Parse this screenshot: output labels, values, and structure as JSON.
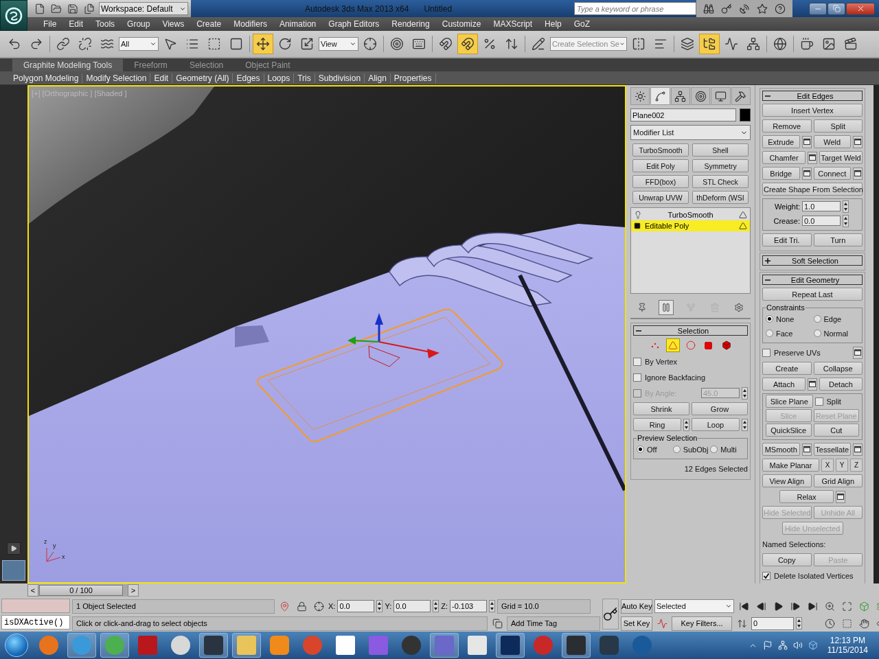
{
  "title_bar": {
    "quick_access": [
      {
        "kind": "new"
      },
      {
        "kind": "open"
      },
      {
        "kind": "save"
      },
      {
        "kind": "project"
      }
    ],
    "workspace": "Workspace: Default",
    "title": "Autodesk 3ds Max  2013 x64",
    "document": "Untitled",
    "search": {
      "placeholder": "Type a keyword or phrase"
    },
    "tools": [
      {
        "kind": "binoculars"
      },
      {
        "kind": "key"
      },
      {
        "kind": "satellite"
      },
      {
        "kind": "star"
      },
      {
        "kind": "help"
      }
    ]
  },
  "menu": [
    "File",
    "Edit",
    "Tools",
    "Group",
    "Views",
    "Create",
    "Modifiers",
    "Animation",
    "Graph Editors",
    "Rendering",
    "Customize",
    "MAXScript",
    "Help",
    "GoZ"
  ],
  "main_toolbar": [
    {
      "kind": "undo",
      "active": false
    },
    {
      "kind": "redo",
      "active": false
    },
    {
      "kind": "sep"
    },
    {
      "kind": "link",
      "active": false
    },
    {
      "kind": "unlink",
      "active": false
    },
    {
      "kind": "bind",
      "active": false
    },
    {
      "kind": "dropdown",
      "value": "All"
    },
    {
      "kind": "select",
      "active": false
    },
    {
      "kind": "select_name",
      "active": false
    },
    {
      "kind": "region",
      "active": false
    },
    {
      "kind": "crossing",
      "active": false
    },
    {
      "kind": "sep"
    },
    {
      "kind": "move",
      "active": true
    },
    {
      "kind": "rotate",
      "active": false
    },
    {
      "kind": "scale",
      "active": false
    },
    {
      "kind": "dropdown",
      "value": "View"
    },
    {
      "kind": "pivot",
      "active": false
    },
    {
      "kind": "sep"
    },
    {
      "kind": "manipulate",
      "active": false
    },
    {
      "kind": "keyboard",
      "active": false
    },
    {
      "kind": "sep"
    },
    {
      "kind": "snap",
      "active": false
    },
    {
      "kind": "angle_snap",
      "active": true
    },
    {
      "kind": "percent",
      "active": false
    },
    {
      "kind": "spinner_snap",
      "active": false
    },
    {
      "kind": "sep"
    },
    {
      "kind": "named_edit",
      "active": false
    },
    {
      "kind": "named_set",
      "placeholder": "Create Selection Se"
    },
    {
      "kind": "mirror",
      "active": false
    },
    {
      "kind": "align",
      "active": false
    },
    {
      "kind": "sep"
    },
    {
      "kind": "layers",
      "active": false
    },
    {
      "kind": "explorer",
      "active": true
    },
    {
      "kind": "curve",
      "active": false
    },
    {
      "kind": "schematic",
      "active": false
    },
    {
      "kind": "sep"
    },
    {
      "kind": "material",
      "active": false
    },
    {
      "kind": "sep"
    },
    {
      "kind": "render_setup",
      "active": false
    },
    {
      "kind": "render_frame",
      "active": false
    },
    {
      "kind": "render",
      "active": false
    }
  ],
  "ribbon": {
    "tabs": [
      {
        "label": "Graphite Modeling Tools",
        "selected": true
      },
      {
        "label": "Freeform",
        "selected": false
      },
      {
        "label": "Selection",
        "selected": false
      },
      {
        "label": "Object Paint",
        "selected": false
      }
    ],
    "panels": [
      "Polygon Modeling",
      "Modify Selection",
      "Edit",
      "Geometry (All)",
      "Edges",
      "Loops",
      "Tris",
      "Subdivision",
      "Align",
      "Properties"
    ]
  },
  "viewport": {
    "label": "[+] [Orthographic ] [Shaded ]",
    "axis_labels": [
      "z",
      "y",
      "x"
    ]
  },
  "command_panel": {
    "tabs": [
      {
        "kind": "create",
        "selected": false
      },
      {
        "kind": "modify",
        "selected": true
      },
      {
        "kind": "hierarchy",
        "selected": false
      },
      {
        "kind": "motion",
        "selected": false
      },
      {
        "kind": "display",
        "selected": false
      },
      {
        "kind": "utilities",
        "selected": false
      }
    ],
    "object_name": "Plane002",
    "modifier_list": "Modifier List",
    "modifier_buttons": [
      "TurboSmooth",
      "Shell",
      "Edit Poly",
      "Symmetry",
      "FFD(box)",
      "STL Check",
      "Unwrap UVW",
      "thDeform (WSI"
    ],
    "stack": [
      {
        "kind": "modifier",
        "label": "TurboSmooth",
        "selected": false
      },
      {
        "kind": "base",
        "label": "Editable Poly",
        "selected": true
      }
    ],
    "stack_tools": [
      {
        "kind": "pin",
        "active": false,
        "disabled": false
      },
      {
        "kind": "end_result",
        "active": true,
        "disabled": false
      },
      {
        "kind": "make_unique",
        "active": false,
        "disabled": true
      },
      {
        "kind": "remove",
        "active": false,
        "disabled": true
      },
      {
        "kind": "configure",
        "active": false,
        "disabled": false
      }
    ],
    "selection": {
      "title": "Selection",
      "expanded": true,
      "subobjects": [
        {
          "kind": "vertex",
          "selected": false
        },
        {
          "kind": "edge",
          "selected": true
        },
        {
          "kind": "border",
          "selected": false
        },
        {
          "kind": "polygon",
          "selected": false
        },
        {
          "kind": "element",
          "selected": false
        }
      ],
      "rows": [
        [
          {
            "kind": "checkbox",
            "label": "By Vertex",
            "checked": false,
            "disabled": false
          }
        ],
        [
          {
            "kind": "checkbox",
            "label": "Ignore Backfacing",
            "checked": false,
            "disabled": false
          }
        ],
        [
          {
            "kind": "checkbox",
            "label": "By Angle:",
            "checked": false,
            "disabled": true
          },
          {
            "kind": "spinner",
            "value": "45.0",
            "disabled": true
          }
        ],
        [
          {
            "kind": "button",
            "label": "Shrink",
            "disabled": false
          },
          {
            "kind": "button",
            "label": "Grow",
            "disabled": false
          }
        ],
        [
          {
            "kind": "button",
            "label": "Ring",
            "disabled": false
          },
          {
            "kind": "arrows"
          },
          {
            "kind": "button",
            "label": "Loop",
            "disabled": false
          },
          {
            "kind": "arrows"
          }
        ],
        [
          {
            "kind": "group",
            "title": "Preview Selection",
            "rows": [
              [
                {
                  "kind": "radio",
                  "label": "Off",
                  "selected": true
                },
                {
                  "kind": "radio",
                  "label": "SubObj",
                  "selected": false
                },
                {
                  "kind": "radio",
                  "label": "Multi",
                  "selected": false
                }
              ]
            ]
          }
        ],
        [
          {
            "kind": "status",
            "label": "12 Edges Selected"
          }
        ]
      ]
    }
  },
  "rollouts": [
    {
      "title": "Edit Edges",
      "expanded": true,
      "rows": [
        [
          {
            "kind": "button",
            "label": "Insert Vertex",
            "disabled": false
          }
        ],
        [
          {
            "kind": "button",
            "label": "Remove",
            "disabled": false
          },
          {
            "kind": "button",
            "label": "Split",
            "disabled": false
          }
        ],
        [
          {
            "kind": "button",
            "label": "Extrude",
            "disabled": false
          },
          {
            "kind": "settings"
          },
          {
            "kind": "button",
            "label": "Weld",
            "disabled": false
          },
          {
            "kind": "settings"
          }
        ],
        [
          {
            "kind": "button",
            "label": "Chamfer",
            "disabled": false
          },
          {
            "kind": "settings"
          },
          {
            "kind": "button",
            "label": "Target Weld",
            "disabled": false
          }
        ],
        [
          {
            "kind": "button",
            "label": "Bridge",
            "disabled": false
          },
          {
            "kind": "settings"
          },
          {
            "kind": "button",
            "label": "Connect",
            "disabled": false
          },
          {
            "kind": "settings"
          }
        ],
        [
          {
            "kind": "button",
            "label": "Create Shape From Selection",
            "disabled": false
          }
        ],
        [
          {
            "kind": "group",
            "rows": [
              [
                {
                  "kind": "spinner",
                  "label": "Weight:",
                  "value": "1.0",
                  "disabled": false
                }
              ],
              [
                {
                  "kind": "spinner",
                  "label": "Crease:",
                  "value": "0.0",
                  "disabled": false
                }
              ]
            ]
          }
        ],
        [
          {
            "kind": "button",
            "label": "Edit Tri.",
            "disabled": false
          },
          {
            "kind": "button",
            "label": "Turn",
            "disabled": false
          }
        ]
      ]
    },
    {
      "title": "Soft Selection",
      "expanded": false
    },
    {
      "title": "Edit Geometry",
      "expanded": true,
      "rows": [
        [
          {
            "kind": "button",
            "label": "Repeat Last",
            "disabled": false
          }
        ],
        [
          {
            "kind": "group",
            "title": "Constraints",
            "rows": [
              [
                {
                  "kind": "radio",
                  "label": "None",
                  "selected": true
                },
                {
                  "kind": "radio",
                  "label": "Edge",
                  "selected": false
                }
              ],
              [
                {
                  "kind": "radio",
                  "label": "Face",
                  "selected": false
                },
                {
                  "kind": "radio",
                  "label": "Normal",
                  "selected": false
                }
              ]
            ]
          }
        ],
        [
          {
            "kind": "checkbox",
            "label": "Preserve UVs",
            "checked": false,
            "disabled": false
          },
          {
            "kind": "settings"
          }
        ],
        [
          {
            "kind": "button",
            "label": "Create",
            "disabled": false
          },
          {
            "kind": "button",
            "label": "Collapse",
            "disabled": false
          }
        ],
        [
          {
            "kind": "button",
            "label": "Attach",
            "disabled": false
          },
          {
            "kind": "settings"
          },
          {
            "kind": "button",
            "label": "Detach",
            "disabled": false
          }
        ],
        [
          {
            "kind": "group",
            "rows": [
              [
                {
                  "kind": "button",
                  "label": "Slice Plane",
                  "disabled": false
                },
                {
                  "kind": "checkbox",
                  "label": "Split",
                  "checked": false,
                  "disabled": false
                }
              ],
              [
                {
                  "kind": "button",
                  "label": "Slice",
                  "disabled": true
                },
                {
                  "kind": "button",
                  "label": "Reset Plane",
                  "disabled": true
                }
              ],
              [
                {
                  "kind": "button",
                  "label": "QuickSlice",
                  "disabled": false
                },
                {
                  "kind": "button",
                  "label": "Cut",
                  "disabled": false
                }
              ]
            ]
          }
        ],
        [
          {
            "kind": "button",
            "label": "MSmooth",
            "disabled": false
          },
          {
            "kind": "settings"
          },
          {
            "kind": "button",
            "label": "Tessellate",
            "disabled": false
          },
          {
            "kind": "settings"
          }
        ],
        [
          {
            "kind": "button",
            "label": "Make Planar",
            "disabled": false
          },
          {
            "kind": "small",
            "label": "X",
            "disabled": false
          },
          {
            "kind": "small",
            "label": "Y",
            "disabled": false
          },
          {
            "kind": "small",
            "label": "Z",
            "disabled": false
          }
        ],
        [
          {
            "kind": "button",
            "label": "View Align",
            "disabled": false
          },
          {
            "kind": "button",
            "label": "Grid Align",
            "disabled": false
          }
        ],
        [
          {
            "kind": "spacer"
          },
          {
            "kind": "button",
            "label": "Relax",
            "disabled": false
          },
          {
            "kind": "settings"
          },
          {
            "kind": "spacer"
          }
        ],
        [
          {
            "kind": "button",
            "label": "Hide Selected",
            "disabled": true
          },
          {
            "kind": "button",
            "label": "Unhide All",
            "disabled": true
          }
        ],
        [
          {
            "kind": "spacer"
          },
          {
            "kind": "button",
            "label": "Hide Unselected",
            "disabled": true
          },
          {
            "kind": "spacer"
          }
        ],
        [
          {
            "kind": "text",
            "label": "Named Selections:"
          }
        ],
        [
          {
            "kind": "button",
            "label": "Copy",
            "disabled": false
          },
          {
            "kind": "button",
            "label": "Paste",
            "disabled": true
          }
        ],
        [
          {
            "kind": "checkbox",
            "label": "Delete Isolated Vertices",
            "checked": true,
            "disabled": false
          }
        ]
      ]
    }
  ],
  "time_slider": {
    "prev": "<",
    "position": "0 / 100",
    "next": ">"
  },
  "status": {
    "listener_input": "isDXActive()",
    "selection": "1 Object Selected",
    "prompt": "Click or click-and-drag to select objects",
    "coords": [
      {
        "label": "X:",
        "value": "0.0"
      },
      {
        "label": "Y:",
        "value": "0.0"
      },
      {
        "label": "Z:",
        "value": "-0.103"
      }
    ],
    "grid": "Grid = 10.0",
    "time_tag": "Add Time Tag"
  },
  "animation": {
    "auto_key": "Auto Key",
    "set_key": "Set Key",
    "key_mode": "Selected",
    "key_filters": "Key Filters...",
    "frame": "0"
  },
  "taskbar": {
    "apps": [
      {
        "kind": "firefox",
        "active": false
      },
      {
        "kind": "ie",
        "active": true
      },
      {
        "kind": "chrome",
        "active": true
      },
      {
        "kind": "filezilla",
        "active": false
      },
      {
        "kind": "ring",
        "active": false
      },
      {
        "kind": "dark",
        "active": true
      },
      {
        "kind": "explorer",
        "active": true
      },
      {
        "kind": "player",
        "active": false
      },
      {
        "kind": "ccleaner",
        "active": false
      },
      {
        "kind": "dropbox",
        "active": false
      },
      {
        "kind": "purple",
        "active": false
      },
      {
        "kind": "monkey",
        "active": false
      },
      {
        "kind": "cinema",
        "active": true
      },
      {
        "kind": "zbrush",
        "active": false
      },
      {
        "kind": "photoshop",
        "active": true
      },
      {
        "kind": "substance",
        "active": false
      },
      {
        "kind": "max",
        "active": true
      },
      {
        "kind": "cdark",
        "active": false
      },
      {
        "kind": "keyshot",
        "active": false
      }
    ],
    "time": "12:13 PM",
    "date": "11/15/2014"
  }
}
